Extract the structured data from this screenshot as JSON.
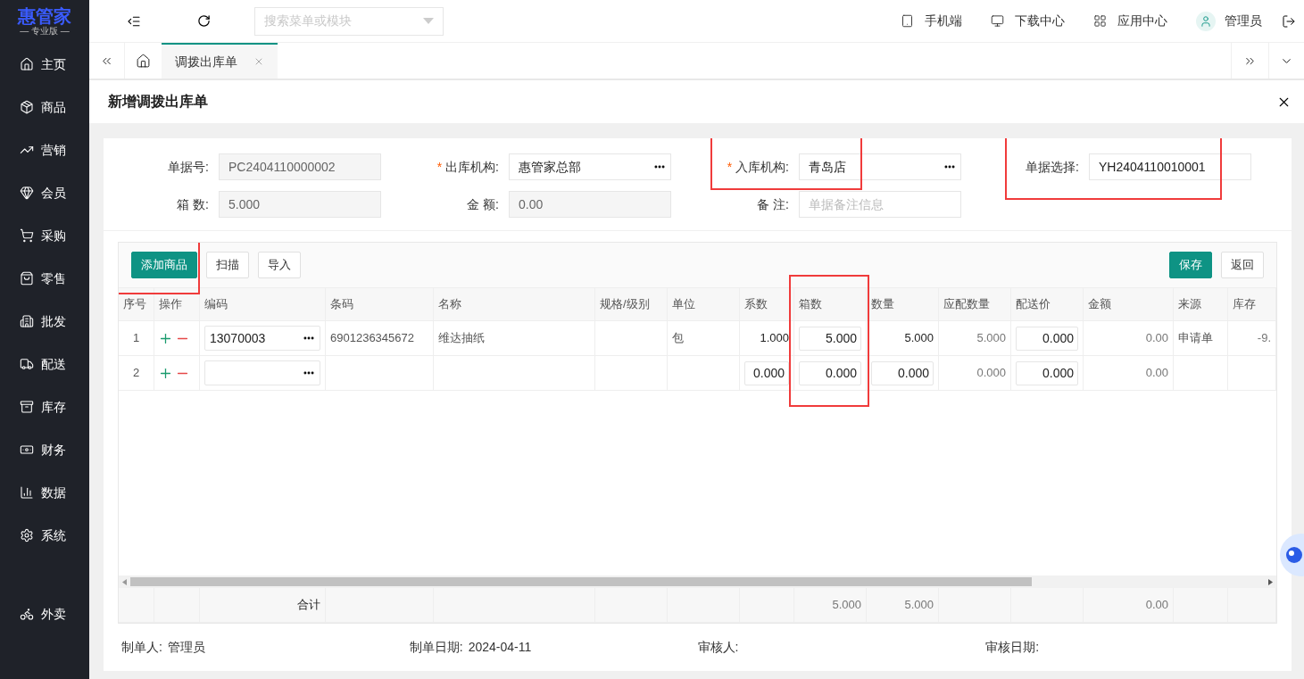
{
  "sidebar": {
    "logo": {
      "title": "惠管家",
      "subtitle": "— 专业版 —"
    },
    "items": [
      {
        "label": "主页"
      },
      {
        "label": "商品"
      },
      {
        "label": "营销"
      },
      {
        "label": "会员"
      },
      {
        "label": "采购"
      },
      {
        "label": "零售"
      },
      {
        "label": "批发"
      },
      {
        "label": "配送"
      },
      {
        "label": "库存"
      },
      {
        "label": "财务"
      },
      {
        "label": "数据"
      },
      {
        "label": "系统"
      }
    ],
    "bottom_items": [
      {
        "label": "外卖"
      }
    ]
  },
  "topbar": {
    "search": {
      "placeholder": "搜索菜单或模块"
    },
    "actions": [
      {
        "label": "手机端"
      },
      {
        "label": "下载中心"
      },
      {
        "label": "应用中心"
      }
    ],
    "user": "管理员"
  },
  "tabs": [
    {
      "label": "调拨出库单",
      "selected": true
    }
  ],
  "page": {
    "title": "新增调拨出库单"
  },
  "form": [
    {
      "label": "单据号:",
      "kind": "readonly",
      "value": "PC2404110000002",
      "highlighted": false
    },
    {
      "marker": "*",
      "label": "出库机构:",
      "kind": "picker",
      "value": "惠管家总部",
      "highlighted": false
    },
    {
      "marker": "*",
      "label": "入库机构:",
      "kind": "picker",
      "value": "青岛店",
      "highlighted": true
    },
    {
      "label": "单据选择:",
      "kind": "input",
      "value": "YH2404110010001",
      "highlighted": true
    },
    {
      "label": "箱 数:",
      "kind": "readonly",
      "value": "5.000",
      "highlighted": false
    },
    {
      "label": "金 额:",
      "kind": "readonly",
      "value": "0.00",
      "highlighted": false
    },
    {
      "label": "备 注:",
      "kind": "input",
      "placeholder": "单据备注信息",
      "highlighted": false
    }
  ],
  "toolbar": {
    "left": [
      {
        "label": "添加商品",
        "kind": "primary",
        "highlighted": true
      },
      {
        "label": "扫描",
        "kind": "default",
        "highlighted": false
      },
      {
        "label": "导入",
        "kind": "default",
        "highlighted": false
      }
    ],
    "right": [
      {
        "label": "保存",
        "kind": "primary",
        "highlighted": false
      },
      {
        "label": "返回",
        "kind": "default",
        "highlighted": false
      }
    ]
  },
  "table": {
    "columns": [
      {
        "label": "序号",
        "highlighted": false
      },
      {
        "label": "操作",
        "highlighted": false
      },
      {
        "label": "编码",
        "highlighted": false
      },
      {
        "label": "条码",
        "highlighted": false
      },
      {
        "label": "名称",
        "highlighted": false
      },
      {
        "label": "规格/级别",
        "highlighted": false
      },
      {
        "label": "单位",
        "highlighted": false
      },
      {
        "label": "系数",
        "highlighted": false
      },
      {
        "label": "箱数",
        "highlighted": true
      },
      {
        "label": "数量",
        "highlighted": false
      },
      {
        "label": "应配数量",
        "highlighted": false
      },
      {
        "label": "配送价",
        "highlighted": false
      },
      {
        "label": "金额",
        "highlighted": false
      },
      {
        "label": "来源",
        "highlighted": false
      },
      {
        "label": "库存",
        "highlighted": false
      }
    ],
    "rows": [
      {
        "cells": [
          {
            "kind": "center",
            "value": "1"
          },
          {
            "kind": "actions"
          },
          {
            "kind": "picker",
            "value": "13070003"
          },
          {
            "kind": "text",
            "value": "6901236345672"
          },
          {
            "kind": "text",
            "value": "维达抽纸"
          },
          {
            "kind": "blank"
          },
          {
            "kind": "text",
            "value": "包"
          },
          {
            "kind": "number",
            "value": "1.000"
          },
          {
            "kind": "input",
            "value": "5.000"
          },
          {
            "kind": "number",
            "value": "5.000"
          },
          {
            "kind": "muted",
            "value": "5.000"
          },
          {
            "kind": "input",
            "value": "0.000"
          },
          {
            "kind": "muted",
            "value": "0.00"
          },
          {
            "kind": "text",
            "value": "申请单"
          },
          {
            "kind": "muted",
            "value": "-9."
          }
        ]
      },
      {
        "cells": [
          {
            "kind": "center",
            "value": "2"
          },
          {
            "kind": "actions"
          },
          {
            "kind": "picker"
          },
          {
            "kind": "blank"
          },
          {
            "kind": "blank"
          },
          {
            "kind": "blank"
          },
          {
            "kind": "blank"
          },
          {
            "kind": "input",
            "value": "0.000"
          },
          {
            "kind": "input",
            "value": "0.000"
          },
          {
            "kind": "input",
            "value": "0.000"
          },
          {
            "kind": "muted",
            "value": "0.000"
          },
          {
            "kind": "input",
            "value": "0.000"
          },
          {
            "kind": "muted",
            "value": "0.00"
          },
          {
            "kind": "blank"
          },
          {
            "kind": "blank"
          }
        ]
      }
    ],
    "totals": [
      {
        "kind": "blank"
      },
      {
        "kind": "blank"
      },
      {
        "kind": "number",
        "value": "合计"
      },
      {
        "kind": "blank"
      },
      {
        "kind": "blank"
      },
      {
        "kind": "blank"
      },
      {
        "kind": "blank"
      },
      {
        "kind": "blank"
      },
      {
        "kind": "muted",
        "value": "5.000"
      },
      {
        "kind": "muted",
        "value": "5.000"
      },
      {
        "kind": "blank"
      },
      {
        "kind": "blank"
      },
      {
        "kind": "muted",
        "value": "0.00"
      },
      {
        "kind": "blank"
      },
      {
        "kind": "blank"
      }
    ]
  },
  "footer": [
    {
      "label": "制单人:",
      "value": "管理员"
    },
    {
      "label": "制单日期:",
      "value": "2024-04-11"
    },
    {
      "label": "审核人:"
    },
    {
      "label": "审核日期:"
    }
  ]
}
